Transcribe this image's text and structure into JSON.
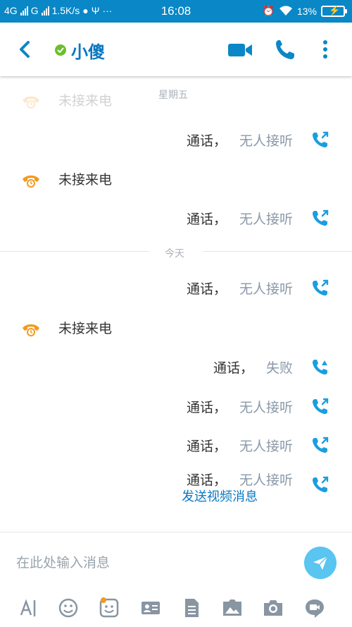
{
  "status_bar": {
    "network1": "4G",
    "network2": "G",
    "speed": "1.5K/s",
    "time": "16:08",
    "battery": "13%"
  },
  "header": {
    "title": "小傻",
    "presence": "online"
  },
  "messages": {
    "day_friday": "星期五",
    "day_today": "今天",
    "missed_call_label": "未接来电",
    "call_label": "通话",
    "comma": "，",
    "no_answer": "无人接听",
    "failed": "失败",
    "send_video_link": "发送视频消息"
  },
  "input": {
    "placeholder": "在此处输入消息"
  },
  "toolbar": {
    "items": [
      "text-format-icon",
      "emoji-icon",
      "sticker-icon",
      "contact-card-icon",
      "file-icon",
      "image-icon",
      "camera-icon",
      "video-message-icon"
    ]
  },
  "colors": {
    "status_bar": "#0a87c6",
    "accent": "#0a78c0",
    "call_icon": "#1a9ee0",
    "missed": "#f39a1e",
    "presence": "#6cbf2b",
    "send_button": "#59c5f0"
  }
}
